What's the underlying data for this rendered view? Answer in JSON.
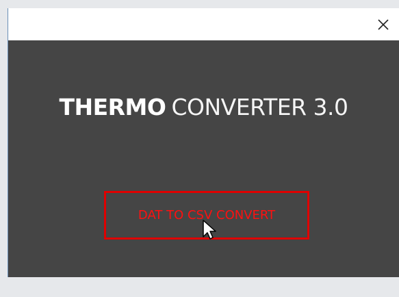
{
  "window": {
    "close_icon": "close-icon"
  },
  "app": {
    "title_bold": "THERMO",
    "title_light": "CONVERTER 3.0"
  },
  "main": {
    "convert_button_label": "DAT TO CSV CONVERT"
  },
  "colors": {
    "background": "#454545",
    "titlebar": "#ffffff",
    "button_border": "#e00000",
    "button_text": "#ff1010"
  },
  "icons": {
    "close": "close-icon",
    "cursor": "mouse-pointer-icon"
  }
}
